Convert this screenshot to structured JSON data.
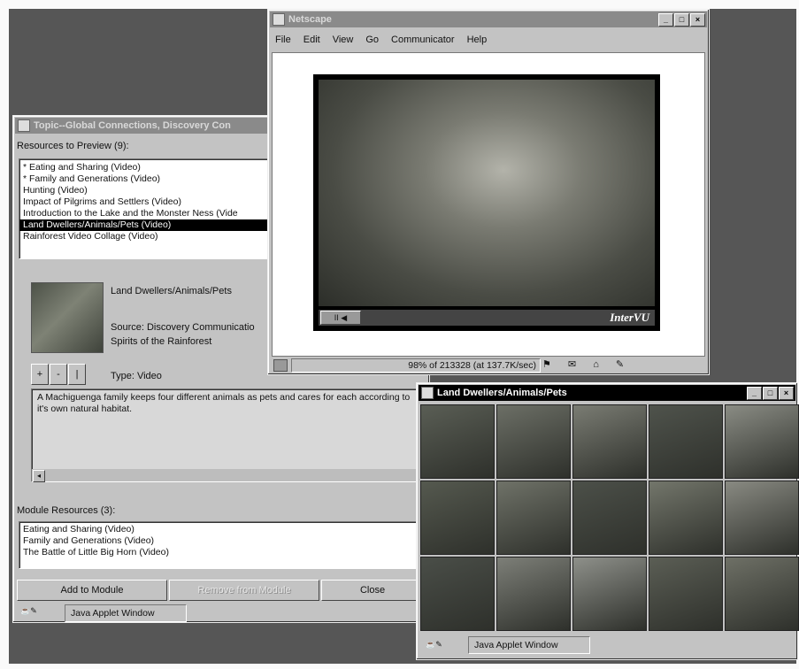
{
  "topic_window": {
    "title": "Topic--Global Connections, Discovery Con",
    "resources_header": "Resources to Preview (9):",
    "resources": [
      {
        "label": "* Eating and Sharing (Video)",
        "selected": false
      },
      {
        "label": "* Family and Generations (Video)",
        "selected": false
      },
      {
        "label": "Hunting (Video)",
        "selected": false
      },
      {
        "label": "Impact of Pilgrims and Settlers (Video)",
        "selected": false
      },
      {
        "label": "Introduction to the Lake and the Monster Ness (Vide",
        "selected": false
      },
      {
        "label": "Land Dwellers/Animals/Pets (Video)",
        "selected": true
      },
      {
        "label": "Rainforest Video Collage (Video)",
        "selected": false
      }
    ],
    "detail": {
      "name": "Land Dwellers/Animals/Pets",
      "source": "Source: Discovery Communicatio",
      "series": "Spirits of the Rainforest",
      "type": "Type: Video",
      "nav_buttons": [
        "+",
        "-",
        "|"
      ],
      "description": "A Machiguenga family keeps four different animals as pets and cares for each according to it's own natural habitat."
    },
    "module_header": "Module Resources (3):",
    "module_resources": [
      "Eating and Sharing (Video)",
      "Family and Generations (Video)",
      "The Battle of Little Big Horn (Video)"
    ],
    "buttons": {
      "add": "Add to Module",
      "remove": "Remove from Module",
      "close": "Close"
    },
    "status": "Java Applet Window"
  },
  "netscape_window": {
    "title": "Netscape",
    "menu": [
      "File",
      "Edit",
      "View",
      "Go",
      "Communicator",
      "Help"
    ],
    "player_brand": "InterVU",
    "player_control": "II ◀",
    "status_text": "98% of 213328 (at 137.7K/sec)"
  },
  "thumbs_window": {
    "title": "Land Dwellers/Animals/Pets",
    "status": "Java Applet Window",
    "thumb_colors": [
      "#5a5e55",
      "#6c6f66",
      "#7a7c73",
      "#4f534c",
      "#8a8c84",
      "#55594f",
      "#6f7268",
      "#4c5049",
      "#73766b",
      "#898a82",
      "#4a4e48",
      "#7d7f78",
      "#8e908a",
      "#5b5e55",
      "#6e7066"
    ]
  },
  "colors": {
    "desktop": "#565656",
    "window_face": "#c3c3c3",
    "selection": "#000000"
  }
}
